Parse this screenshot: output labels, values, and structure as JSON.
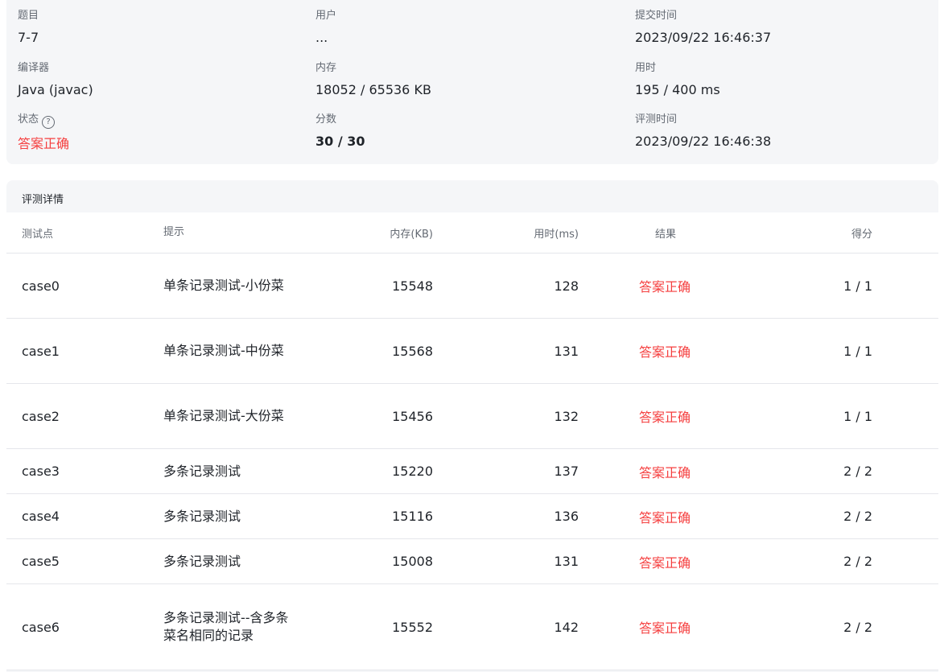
{
  "summary": {
    "problem": {
      "label": "题目",
      "value": "7-7"
    },
    "user": {
      "label": "用户",
      "value": "..."
    },
    "submit_time": {
      "label": "提交时间",
      "value": "2023/09/22 16:46:37"
    },
    "compiler": {
      "label": "编译器",
      "value": "Java (javac)"
    },
    "memory": {
      "label": "内存",
      "value": "18052 / 65536 KB"
    },
    "time_used": {
      "label": "用时",
      "value": "195 / 400 ms"
    },
    "status": {
      "label": "状态",
      "value": "答案正确",
      "help": "?"
    },
    "score": {
      "label": "分数",
      "value": "30 / 30"
    },
    "judge_time": {
      "label": "评测时间",
      "value": "2023/09/22 16:46:38"
    }
  },
  "detail": {
    "title": "评测详情",
    "headers": [
      "测试点",
      "提示",
      "内存(KB)",
      "用时(ms)",
      "结果",
      "得分"
    ],
    "rows": [
      {
        "case": "case0",
        "hint": "单条记录测试-小份菜",
        "memory": "15548",
        "time": "128",
        "result": "答案正确",
        "score": "1 / 1"
      },
      {
        "case": "case1",
        "hint": "单条记录测试-中份菜",
        "memory": "15568",
        "time": "131",
        "result": "答案正确",
        "score": "1 / 1"
      },
      {
        "case": "case2",
        "hint": "单条记录测试-大份菜",
        "memory": "15456",
        "time": "132",
        "result": "答案正确",
        "score": "1 / 1"
      },
      {
        "case": "case3",
        "hint": "多条记录测试",
        "memory": "15220",
        "time": "137",
        "result": "答案正确",
        "score": "2 / 2"
      },
      {
        "case": "case4",
        "hint": "多条记录测试",
        "memory": "15116",
        "time": "136",
        "result": "答案正确",
        "score": "2 / 2"
      },
      {
        "case": "case5",
        "hint": "多条记录测试",
        "memory": "15008",
        "time": "131",
        "result": "答案正确",
        "score": "2 / 2"
      },
      {
        "case": "case6",
        "hint": "多条记录测试--含多条菜名相同的记录",
        "memory": "15552",
        "time": "142",
        "result": "答案正确",
        "score": "2 / 2"
      }
    ]
  }
}
